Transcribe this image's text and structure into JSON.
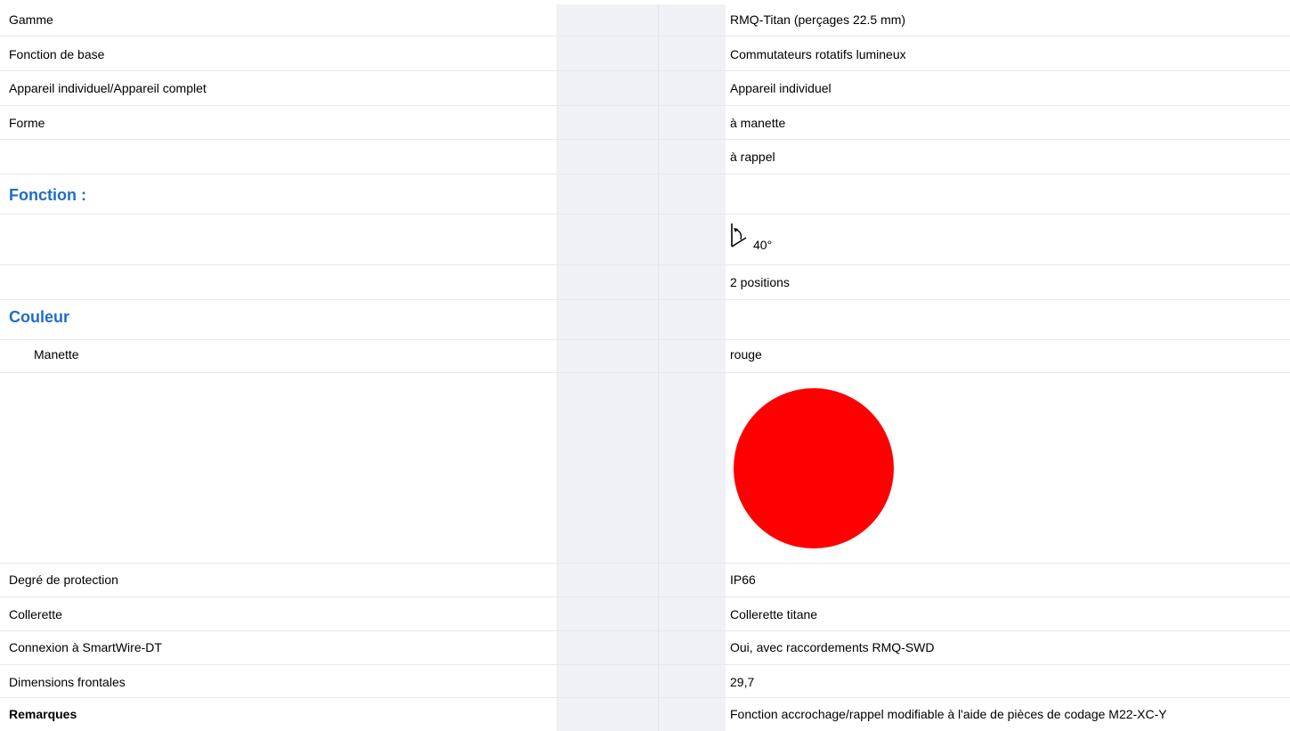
{
  "rows": [
    {
      "label": "Gamme",
      "value": "RMQ-Titan (perçages 22.5 mm)"
    },
    {
      "label": "Fonction de base",
      "value": "Commutateurs rotatifs lumineux"
    },
    {
      "label": "Appareil individuel/Appareil complet",
      "value": "Appareil individuel"
    },
    {
      "label": "Forme",
      "value": "à manette"
    },
    {
      "label": "",
      "value": "à rappel"
    }
  ],
  "fonction": {
    "heading": "Fonction :",
    "angle_icon": "rotation-angle-icon",
    "angle": "40°",
    "positions": "2 positions"
  },
  "couleur": {
    "heading": "Couleur",
    "manette_label": "Manette",
    "manette_value": "rouge",
    "swatch_color": "#ff0000",
    "swatch_icon": "color-swatch-circle"
  },
  "rows2": [
    {
      "label": "Degré de protection",
      "value": "IP66"
    },
    {
      "label": "Collerette",
      "value": "Collerette titane"
    },
    {
      "label": "Connexion à SmartWire-DT",
      "value": "Oui, avec raccordements RMQ-SWD"
    },
    {
      "label": "Dimensions frontales",
      "value": "29,7"
    }
  ],
  "remarques": {
    "label": "Remarques",
    "value": "Fonction accrochage/rappel modifiable à l'aide de pièces de codage M22-XC-Y"
  },
  "colors": {
    "heading": "#1e6ec4",
    "shade": "#eff1f5",
    "divider": "#e7e8ec"
  }
}
